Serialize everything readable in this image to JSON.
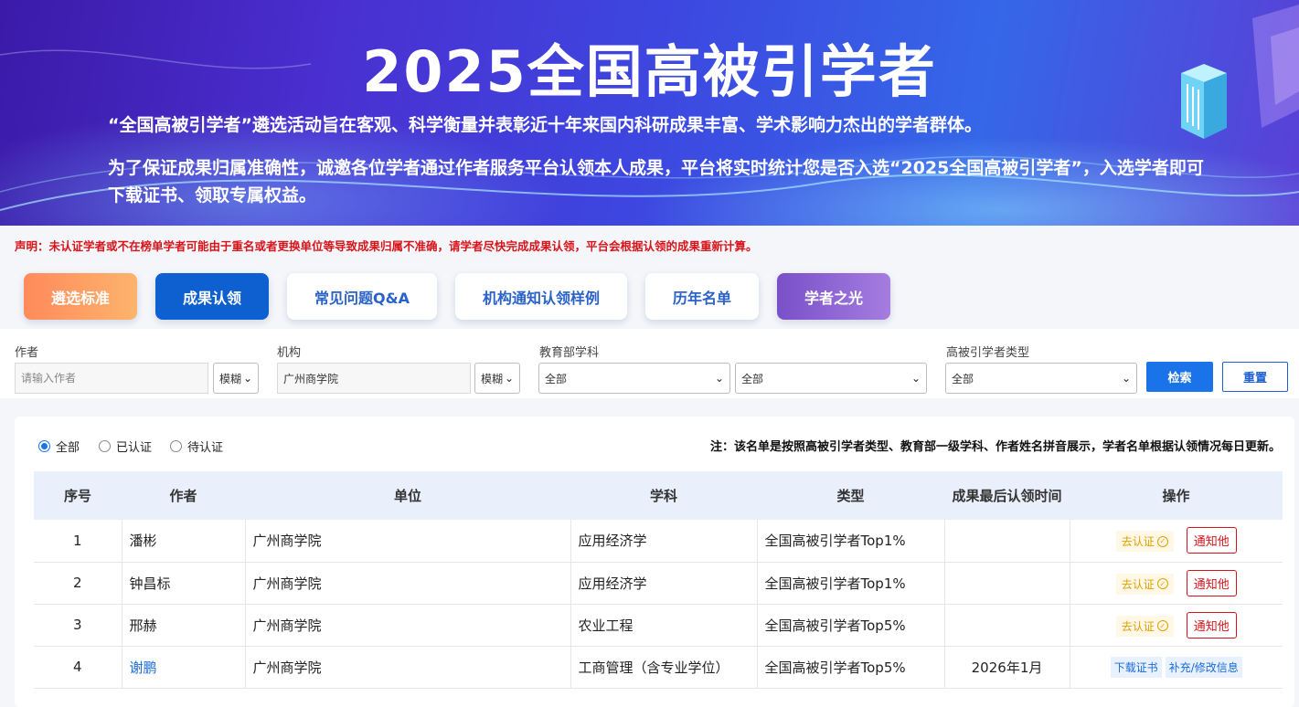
{
  "banner": {
    "title": "2025全国高被引学者",
    "para1": "“全国高被引学者”遴选活动旨在客观、科学衡量并表彰近十年来国内科研成果丰富、学术影响力杰出的学者群体。",
    "para2": "为了保证成果归属准确性，诚邀各位学者通过作者服务平台认领本人成果，平台将实时统计您是否入选“2025全国高被引学者”，入选学者即可下载证书、领取专属权益。"
  },
  "notice": "声明：未认证学者或不在榜单学者可能由于重名或者更换单位等导致成果归属不准确，请学者尽快完成成果认领，平台会根据认领的成果重新计算。",
  "tabs": [
    "遴选标准",
    "成果认领",
    "常见问题Q&A",
    "机构通知认领样例",
    "历年名单",
    "学者之光"
  ],
  "filters": {
    "author_label": "作者",
    "author_placeholder": "请输入作者",
    "author_match": "模糊",
    "org_label": "机构",
    "org_value": "广州商学院",
    "org_match": "模糊",
    "subject_label": "教育部学科",
    "subject1": "全部",
    "subject2": "全部",
    "type_label": "高被引学者类型",
    "type_value": "全部",
    "search": "检索",
    "reset": "重置"
  },
  "radios": [
    "全部",
    "已认证",
    "待认证"
  ],
  "note": "注：该名单是按照高被引学者类型、教育部一级学科、作者姓名拼音展示，学者名单根据认领情况每日更新。",
  "table": {
    "headers": [
      "序号",
      "作者",
      "单位",
      "学科",
      "类型",
      "成果最后认领时间",
      "操作"
    ],
    "rows": [
      {
        "no": "1",
        "author": "潘彬",
        "org": "广州商学院",
        "subject": "应用经济学",
        "type": "全国高被引学者Top1%",
        "time": "",
        "verify": "去认证",
        "notify": "通知他"
      },
      {
        "no": "2",
        "author": "钟昌标",
        "org": "广州商学院",
        "subject": "应用经济学",
        "type": "全国高被引学者Top1%",
        "time": "",
        "verify": "去认证",
        "notify": "通知他"
      },
      {
        "no": "3",
        "author": "邢赫",
        "org": "广州商学院",
        "subject": "农业工程",
        "type": "全国高被引学者Top5%",
        "time": "",
        "verify": "去认证",
        "notify": "通知他"
      },
      {
        "no": "4",
        "author": "谢鹏",
        "org": "广州商学院",
        "subject": "工商管理（含专业学位）",
        "type": "全国高被引学者Top5%",
        "time": "2026年1月",
        "download": "下载证书",
        "edit": "补充/修改信息"
      }
    ]
  },
  "colors": {
    "primary": "#1a73e8",
    "danger": "#d8141b",
    "warn": "#e0a000"
  }
}
